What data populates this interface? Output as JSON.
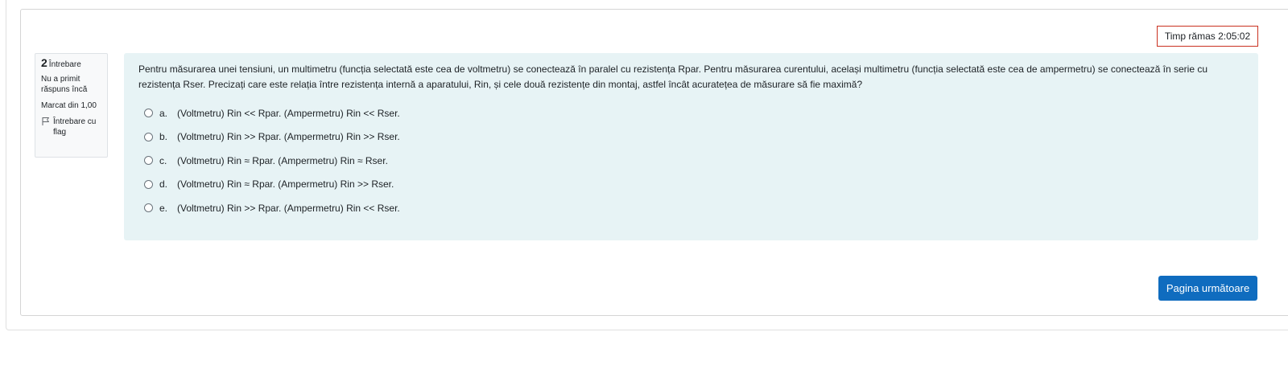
{
  "timer": {
    "label": "Timp rămas 2:05:02"
  },
  "question_info": {
    "number": "2",
    "number_label": "Întrebare",
    "state": "Nu a primit răspuns încă",
    "grade": "Marcat din 1,00",
    "flag_label": "Întrebare cu flag",
    "flag_icon": "flag-icon"
  },
  "question": {
    "text": "Pentru măsurarea unei tensiuni, un multimetru (funcția selectată este cea de voltmetru) se conectează în paralel cu rezistența Rpar. Pentru măsurarea curentului, același multimetru (funcția selectată este cea de ampermetru) se conectează în serie cu rezistența Rser.  Precizați care este relația între rezistența internă a aparatului, Rin, și cele două rezistențe din montaj, astfel încât acuratețea de măsurare să fie maximă?",
    "answers": [
      {
        "letter": "a.",
        "text": "(Voltmetru) Rin << Rpar. (Ampermetru) Rin << Rser."
      },
      {
        "letter": "b.",
        "text": "(Voltmetru) Rin >> Rpar. (Ampermetru) Rin >> Rser."
      },
      {
        "letter": "c.",
        "text": "(Voltmetru) Rin ≈ Rpar. (Ampermetru) Rin ≈ Rser."
      },
      {
        "letter": "d.",
        "text": "(Voltmetru) Rin ≈ Rpar. (Ampermetru) Rin >> Rser."
      },
      {
        "letter": "e.",
        "text": "(Voltmetru) Rin >> Rpar. (Ampermetru) Rin << Rser."
      }
    ]
  },
  "navigation": {
    "next_label": "Pagina următoare"
  },
  "colors": {
    "primary": "#0f6cbf",
    "content_bg": "#e7f3f5",
    "timer_border": "#ca3120"
  }
}
